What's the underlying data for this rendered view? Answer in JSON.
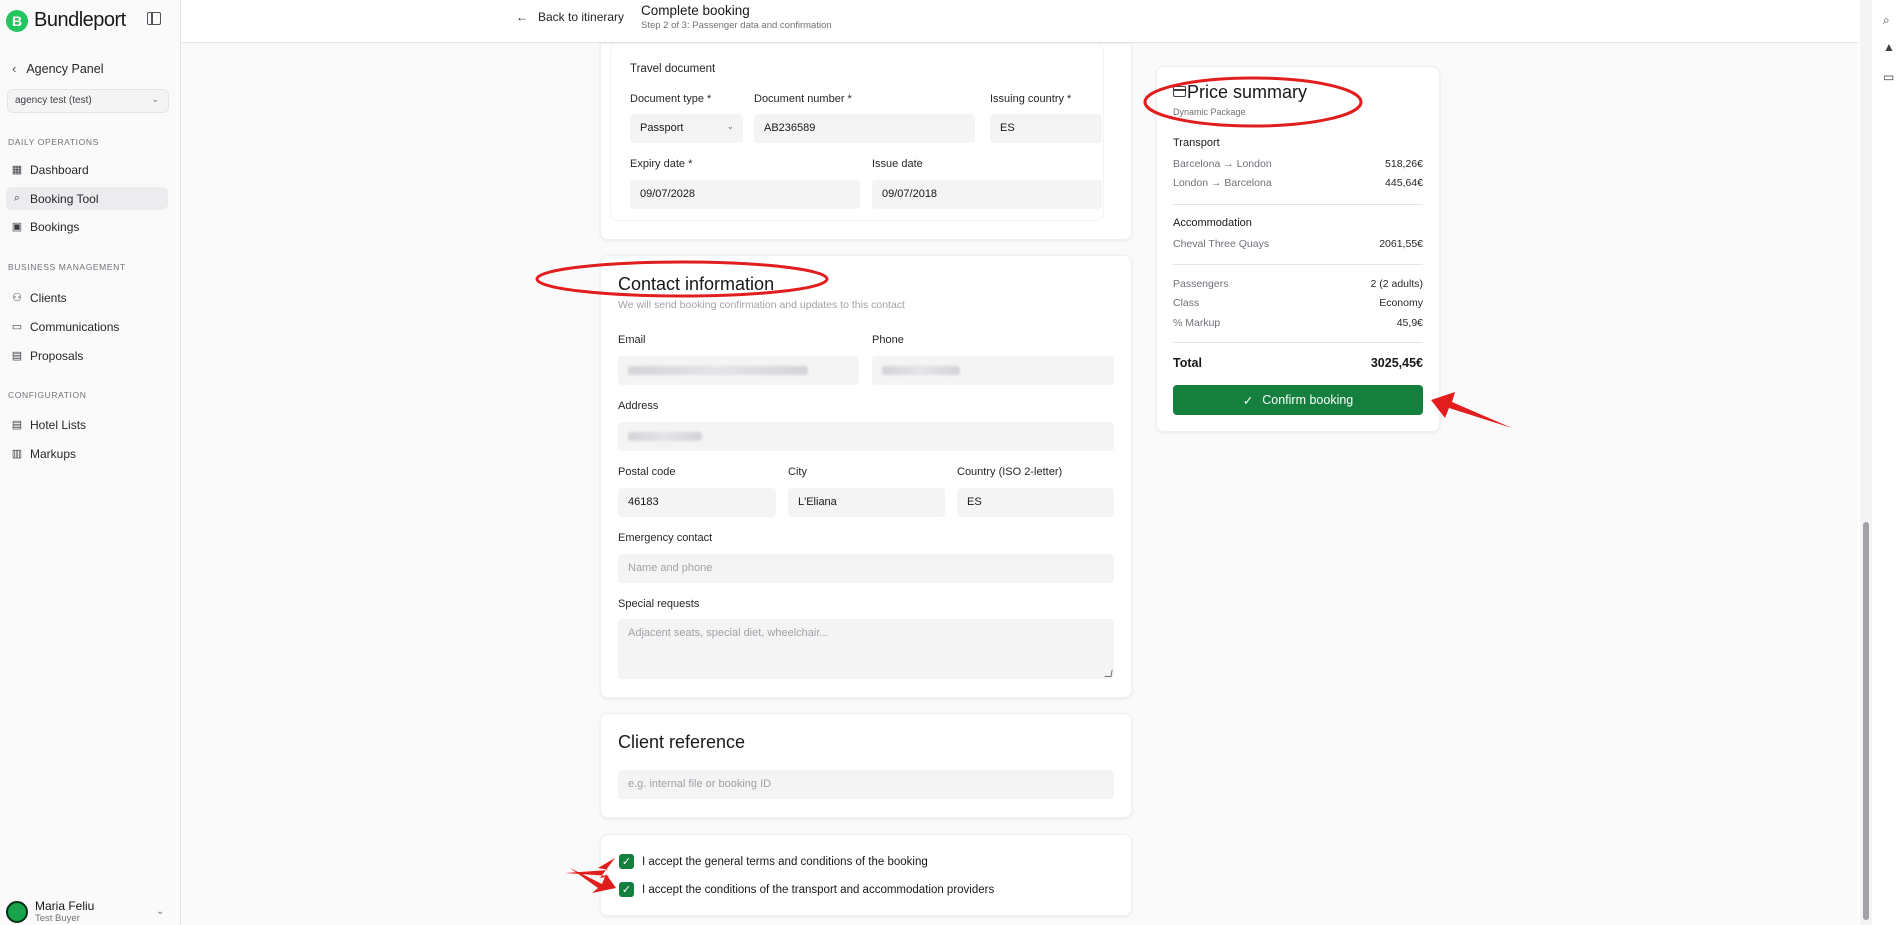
{
  "brand": {
    "logo_letter": "B",
    "name": "Bundleport"
  },
  "sidebar": {
    "back_label": "Agency Panel",
    "agency_select": "agency test (test)",
    "sections": [
      {
        "label": "DAILY OPERATIONS",
        "items": [
          {
            "label": "Dashboard",
            "icon": "dashboard-icon"
          },
          {
            "label": "Booking Tool",
            "icon": "search-icon",
            "active": true
          },
          {
            "label": "Bookings",
            "icon": "calendar-icon"
          }
        ]
      },
      {
        "label": "BUSINESS MANAGEMENT",
        "items": [
          {
            "label": "Clients",
            "icon": "user-icon"
          },
          {
            "label": "Communications",
            "icon": "message-icon"
          },
          {
            "label": "Proposals",
            "icon": "document-icon"
          }
        ]
      },
      {
        "label": "CONFIGURATION",
        "items": [
          {
            "label": "Hotel Lists",
            "icon": "list-icon"
          },
          {
            "label": "Markups",
            "icon": "receipt-icon"
          }
        ]
      }
    ],
    "user": {
      "name": "Maria Feliu",
      "role": "Test Buyer"
    }
  },
  "header": {
    "back_label": "Back to itinerary",
    "title": "Complete booking",
    "subtitle": "Step 2 of 3: Passenger data and confirmation"
  },
  "travel_document": {
    "title": "Travel document",
    "document_type_label": "Document type *",
    "document_type_value": "Passport",
    "document_number_label": "Document number *",
    "document_number_value": "AB236589",
    "issuing_country_label": "Issuing country *",
    "issuing_country_value": "ES",
    "expiry_date_label": "Expiry date *",
    "expiry_date_value": "09/07/2028",
    "issue_date_label": "Issue date",
    "issue_date_value": "09/07/2018"
  },
  "contact": {
    "title": "Contact information",
    "subtitle": "We will send booking confirmation and updates to this contact",
    "email_label": "Email",
    "phone_label": "Phone",
    "address_label": "Address",
    "postal_code_label": "Postal code",
    "postal_code_value": "46183",
    "city_label": "City",
    "city_value": "L'Eliana",
    "country_label": "Country (ISO 2-letter)",
    "country_value": "ES",
    "emergency_label": "Emergency contact",
    "emergency_placeholder": "Name and phone",
    "special_label": "Special requests",
    "special_placeholder": "Adjacent seats, special diet, wheelchair..."
  },
  "client_reference": {
    "title": "Client reference",
    "placeholder": "e.g. internal file or booking ID"
  },
  "terms": {
    "general": "I accept the general terms and conditions of the booking",
    "providers": "I accept the conditions of the transport and accommodation providers"
  },
  "price_summary": {
    "title": "Price summary",
    "subtitle": "Dynamic Package",
    "transport_label": "Transport",
    "transport": [
      {
        "label": "Barcelona → London",
        "value": "518,26€"
      },
      {
        "label": "London → Barcelona",
        "value": "445,64€"
      }
    ],
    "accommodation_label": "Accommodation",
    "accommodation": [
      {
        "label": "Cheval Three Quays",
        "value": "2061,55€"
      }
    ],
    "details": [
      {
        "label": "Passengers",
        "value": "2 (2 adults)"
      },
      {
        "label": "Class",
        "value": "Economy"
      },
      {
        "label": "% Markup",
        "value": "45,9€"
      }
    ],
    "total_label": "Total",
    "total_value": "3025,45€",
    "confirm_label": "Confirm booking"
  },
  "colors": {
    "accent": "#15803d",
    "brand": "#22c55e",
    "annotation": "#e11d1d"
  }
}
